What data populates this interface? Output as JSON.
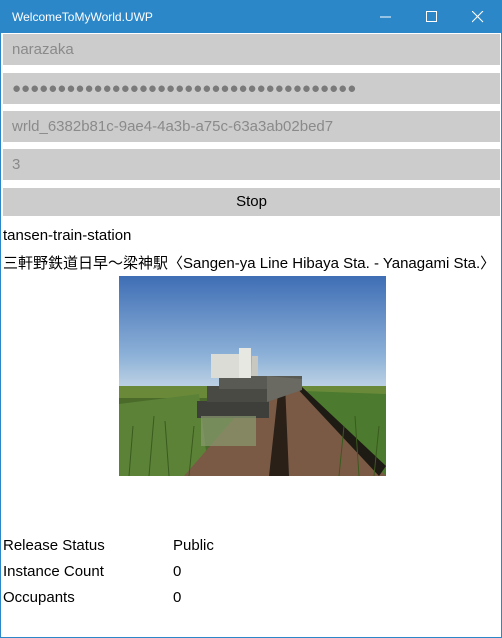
{
  "window": {
    "title": "WelcomeToMyWorld.UWP",
    "accent": "#2b87c8"
  },
  "form": {
    "username": "narazaka",
    "password_mask": "●●●●●●●●●●●●●●●●●●●●●●●●●●●●●●●●●●●●●●",
    "world_id": "wrld_6382b81c-9ae4-4a3b-a75c-63a3ab02bed7",
    "interval": "3",
    "stop_label": "Stop"
  },
  "world": {
    "name": "tansen-train-station",
    "description": "三軒野鉄道日早～梁神駅〈Sangen-ya Line Hibaya Sta. - Yanagami Sta.〉"
  },
  "details": [
    {
      "label": "Release Status",
      "value": "Public"
    },
    {
      "label": "Instance Count",
      "value": "0"
    },
    {
      "label": "Occupants",
      "value": "0"
    }
  ]
}
